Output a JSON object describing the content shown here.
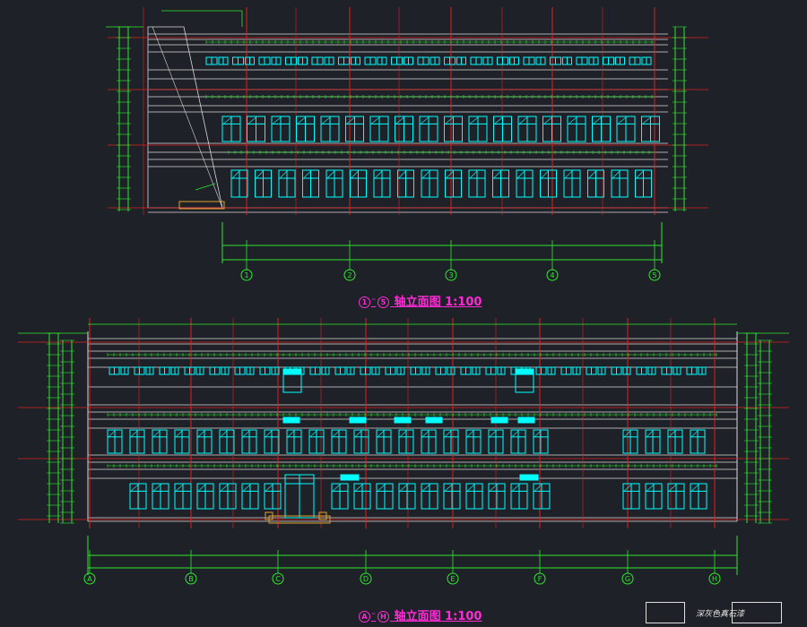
{
  "title_top": {
    "from": "1",
    "to": "5",
    "label": "轴立面图 1:100"
  },
  "title_bottom": {
    "from": "A",
    "to": "H",
    "label": "轴立面图 1:100"
  },
  "grid_top": [
    "1",
    "2",
    "3",
    "4",
    "5"
  ],
  "grid_bottom": [
    "A",
    "B",
    "C",
    "D",
    "E",
    "F",
    "G",
    "H"
  ],
  "legend_label": "深灰色真石漆",
  "colors": {
    "background": "#1e2228",
    "grid_line": "#e02020",
    "dimension": "#2ee82e",
    "window": "#00ffff",
    "floor_line": "#d8d8d8",
    "title": "#ff2bd6",
    "text": "#ffffff"
  }
}
